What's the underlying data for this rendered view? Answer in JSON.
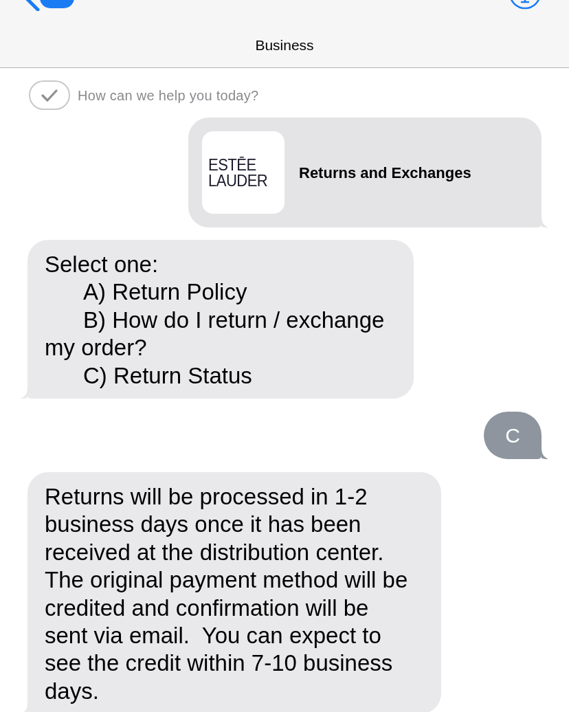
{
  "header": {
    "title": "Business"
  },
  "prompt": {
    "text": "How can we help you today?"
  },
  "messages": [
    {
      "kind": "link",
      "outgoing": true,
      "title": "Returns and Exchanges",
      "logo_lines": [
        "ESTĒE",
        "LAUDER"
      ]
    },
    {
      "kind": "options",
      "outgoing": false,
      "intro": "Select one:",
      "options": [
        "A) Return Policy",
        "B) How do I return / exchange my order?",
        "C) Return Status"
      ]
    },
    {
      "kind": "text",
      "outgoing": true,
      "text": "C"
    },
    {
      "kind": "text",
      "outgoing": false,
      "text": "Returns will be processed in 1-2 business days once it has been received at the distribution center. The original payment method will be credited and confirmation will be sent via email.  You can expect to see the credit within 7-10 business days."
    }
  ]
}
